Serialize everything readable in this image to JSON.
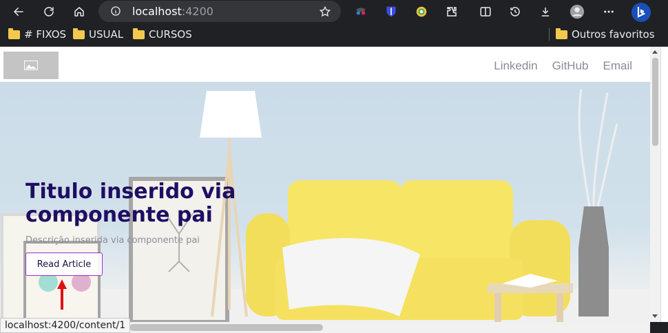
{
  "browser": {
    "url_host": "localhost",
    "url_port": ":4200",
    "bookmarks": [
      "# FIXOS",
      "USUAL",
      "CURSOS"
    ],
    "other_bookmarks": "Outros favoritos"
  },
  "navbar": {
    "links": [
      "Linkedin",
      "GitHub",
      "Email"
    ]
  },
  "hero": {
    "title": "Titulo inserido via componente pai",
    "description": "Descrição inserida via componente pai",
    "button_label": "Read Article"
  },
  "status_bar": {
    "url": "localhost:4200/content/1"
  },
  "colors": {
    "title": "#1f0e63",
    "button_border": "#9a2fd0",
    "arrow": "#e01010",
    "sofa": "#f5de3a"
  }
}
